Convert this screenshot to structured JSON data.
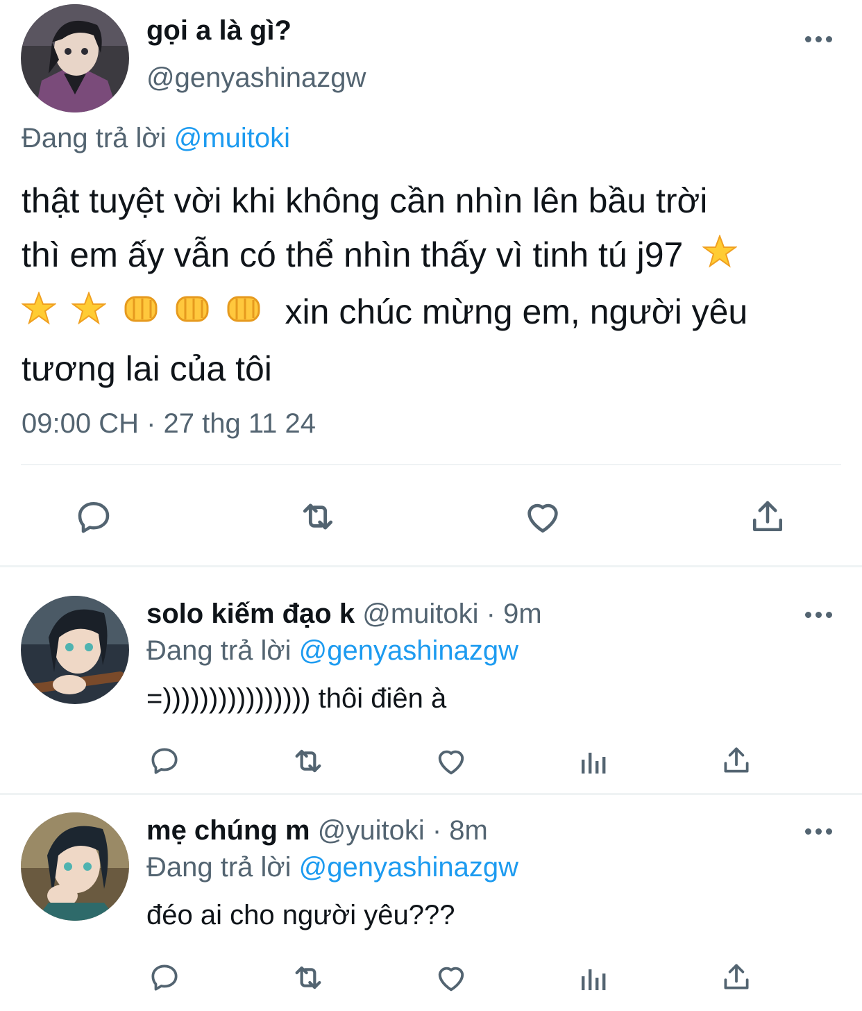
{
  "main_tweet": {
    "display_name": "gọi a là gì?",
    "handle": "@genyashinazgw",
    "reply_prefix": "Đang trả lời",
    "reply_to": "@muitoki",
    "text_line1": "thật tuyệt vời khi không cần nhìn lên bầu trời",
    "text_line2": "thì em ấy vẫn có thể nhìn thấy vì tinh tú j97",
    "text_line3": "xin chúc mừng em, người yêu",
    "text_line4": "tương lai của tôi",
    "timestamp": "09:00 CH · 27 thg 11 24",
    "icons": [
      "reply-icon",
      "retweet-icon",
      "like-icon",
      "share-icon"
    ]
  },
  "replies": [
    {
      "display_name": "solo kiếm đạo k",
      "handle": "@muitoki",
      "time": "· 9m",
      "reply_prefix": "Đang trả lời",
      "reply_to": "@genyashinazgw",
      "text": "=)))))))))))))))) thôi điên à"
    },
    {
      "display_name": "mẹ chúng m",
      "handle": "@yuitoki",
      "time": "· 8m",
      "reply_prefix": "Đang trả lời",
      "reply_to": "@genyashinazgw",
      "text": "đéo ai cho người yêu???"
    }
  ],
  "colors": {
    "text": "#0f1419",
    "secondary": "#536471",
    "link": "#1d9bf0",
    "divider": "#eff3f4"
  }
}
